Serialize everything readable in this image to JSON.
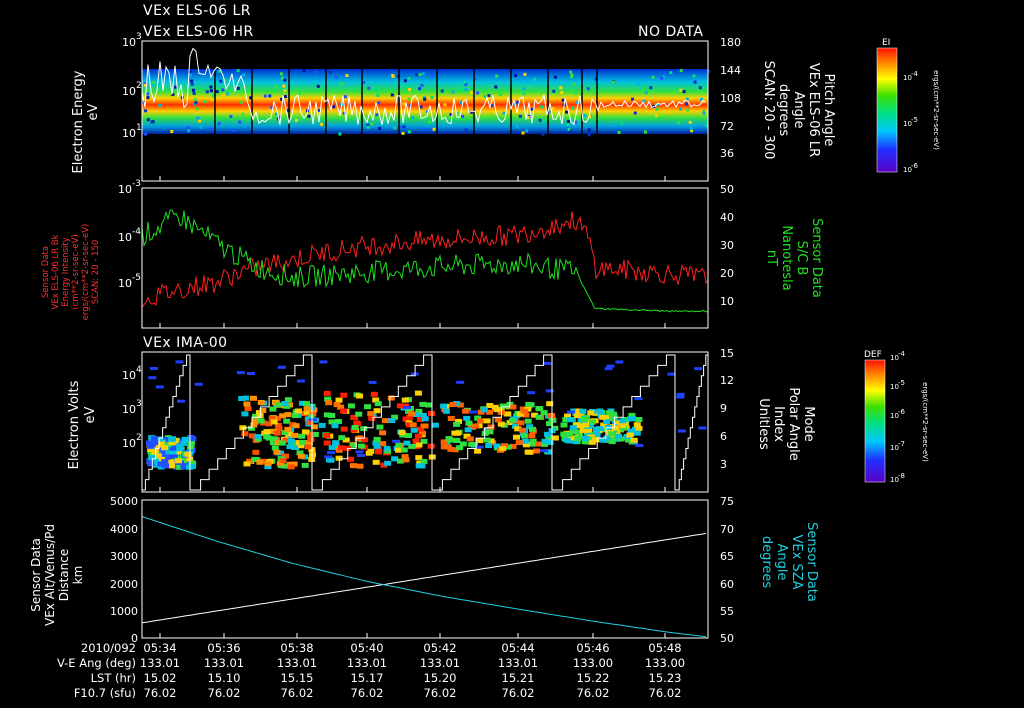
{
  "header": {
    "line1": "VEx ELS-06 LR",
    "line2": "VEx ELS-06 HR",
    "no_data": "NO DATA"
  },
  "panel1": {
    "ylabel": "Electron Energy",
    "yunit": "eV",
    "yticks": [
      "10",
      "10",
      "10"
    ],
    "yexp": [
      "3",
      "2",
      "1"
    ],
    "rticks": [
      "180",
      "144",
      "108",
      "72",
      "36"
    ],
    "rlabel1": "Pitch Angle",
    "rlabel2": "VEx ELS-06 LR",
    "rlabel3": "Angle",
    "rlabel4": "degrees",
    "rlabel5": "SCAN: 20 - 300",
    "cbar_title": "EI",
    "cbar_label": "ergs/(cm**2-sr-sec-eV)",
    "cbar_ticks": [
      "10",
      "10",
      "10"
    ],
    "cbar_exp": [
      "-4",
      "-5",
      "-6"
    ]
  },
  "panel2": {
    "lticks": [
      "10",
      "10",
      "10"
    ],
    "lexp": [
      "-3",
      "-4",
      "-5"
    ],
    "llabel1": "Sensor Data",
    "llabel2": "VEx ELS-06 LR Bk",
    "llabel3": "Energy Intensity",
    "llabel4": "(cm**2-sr-sec-eV)",
    "llabel5": "ergs/(cm**2-sr-sec-eV)",
    "llabel6": "SCAN: 20 - 150",
    "rticks": [
      "50",
      "40",
      "30",
      "20",
      "10"
    ],
    "rlabel1": "Sensor Data",
    "rlabel2": "S/C B",
    "rlabel3": "Nanotesla",
    "rlabel4": "nT"
  },
  "panel3": {
    "title": "VEx IMA-00",
    "ylabel": "Electron Volts",
    "yunit": "eV",
    "yticks": [
      "10",
      "10",
      "10"
    ],
    "yexp": [
      "4",
      "3",
      "2"
    ],
    "rticks": [
      "15",
      "12",
      "9",
      "6",
      "3"
    ],
    "rlabel1": "Mode",
    "rlabel2": "Polar Angle",
    "rlabel3": "Index",
    "rlabel4": "Unitless",
    "cbar_title": "DEF",
    "cbar_label": "ergs/(cm**2-sr-sec-eV)",
    "cbar_ticks": [
      "10",
      "10",
      "10",
      "10",
      "10"
    ],
    "cbar_exp": [
      "-4",
      "-5",
      "-6",
      "-7",
      "-8"
    ]
  },
  "panel4": {
    "lticks": [
      "5000",
      "4000",
      "3000",
      "2000",
      "1000",
      "0"
    ],
    "llabel1": "Sensor Data",
    "llabel2": "VEx Alt/Venus/Pd",
    "llabel3": "Distance",
    "llabel4": "km",
    "rticks": [
      "75",
      "70",
      "65",
      "60",
      "55",
      "50"
    ],
    "rlabel1": "Sensor Data",
    "rlabel2": "VEx SZA",
    "rlabel3": "Angle",
    "rlabel4": "degrees"
  },
  "footer": {
    "row_labels": [
      "2010/092",
      "V-E Ang (deg)",
      "LST (hr)",
      "F10.7 (sfu)"
    ],
    "times": [
      "05:34",
      "05:36",
      "05:38",
      "05:40",
      "05:42",
      "05:44",
      "05:46",
      "05:48"
    ],
    "ve_ang": [
      "133.01",
      "133.01",
      "133.01",
      "133.01",
      "133.01",
      "133.01",
      "133.00",
      "133.00"
    ],
    "lst": [
      "15.02",
      "15.10",
      "15.15",
      "15.17",
      "15.20",
      "15.21",
      "15.22",
      "15.23"
    ],
    "f107": [
      "76.02",
      "76.02",
      "76.02",
      "76.02",
      "76.02",
      "76.02",
      "76.02",
      "76.02"
    ]
  },
  "colors": {
    "background": "#000000",
    "axes": "#ffffff",
    "intensity_trace": "#ff2020",
    "b_field_trace": "#20e020",
    "altitude_trace": "#ffffff",
    "sza_trace": "#20d0e0"
  },
  "chart_data": [
    {
      "type": "heatmap",
      "ylabel": "Electron Energy",
      "yunit": "eV",
      "yscale": "log",
      "ylim": [
        5,
        1000
      ],
      "right_axis": {
        "label": "Pitch Angle",
        "ylim": [
          0,
          180
        ]
      },
      "time_range": [
        "05:34",
        "05:49"
      ],
      "band_center_eV": 50
    },
    {
      "type": "line",
      "series": [
        {
          "name": "Energy Intensity",
          "axis": "left",
          "yscale": "log",
          "x": [
            "05:34",
            "05:36",
            "05:38",
            "05:40",
            "05:42",
            "05:44",
            "05:45:30",
            "05:46",
            "05:48",
            "05:49"
          ],
          "values": [
            4e-06,
            1e-05,
            3e-05,
            6e-05,
            8e-05,
            0.0001,
            0.0002,
            2e-05,
            1.5e-05,
            1.2e-05
          ]
        },
        {
          "name": "S/C B",
          "axis": "right",
          "unit": "nT",
          "x": [
            "05:34",
            "05:35",
            "05:36",
            "05:37",
            "05:38",
            "05:40",
            "05:42",
            "05:44",
            "05:45:30",
            "05:46",
            "05:48",
            "05:49"
          ],
          "values": [
            33,
            40,
            30,
            22,
            18,
            20,
            22,
            23,
            20,
            7,
            6,
            6
          ]
        }
      ],
      "ylim_left": [
        5e-07,
        0.001
      ],
      "ylim_right": [
        0,
        50
      ]
    },
    {
      "type": "heatmap",
      "ylabel": "Electron Volts",
      "yunit": "eV",
      "yscale": "log",
      "ylim": [
        20,
        40000
      ],
      "right_axis": {
        "label": "Polar Angle",
        "ylim": [
          0,
          15
        ]
      }
    },
    {
      "type": "line",
      "series": [
        {
          "name": "VEx Alt/Venus/Pd",
          "axis": "left",
          "unit": "km",
          "x": [
            "05:34",
            "05:49"
          ],
          "values": [
            550,
            3800
          ]
        },
        {
          "name": "VEx SZA",
          "axis": "right",
          "unit": "degrees",
          "x": [
            "05:34",
            "05:36",
            "05:38",
            "05:40",
            "05:42",
            "05:44",
            "05:46",
            "05:48",
            "05:49"
          ],
          "values": [
            72,
            67.5,
            63.5,
            60.2,
            57.5,
            55.2,
            53.0,
            51.0,
            50.2
          ]
        }
      ],
      "ylim_left": [
        0,
        5000
      ],
      "ylim_right": [
        50,
        75
      ]
    }
  ]
}
